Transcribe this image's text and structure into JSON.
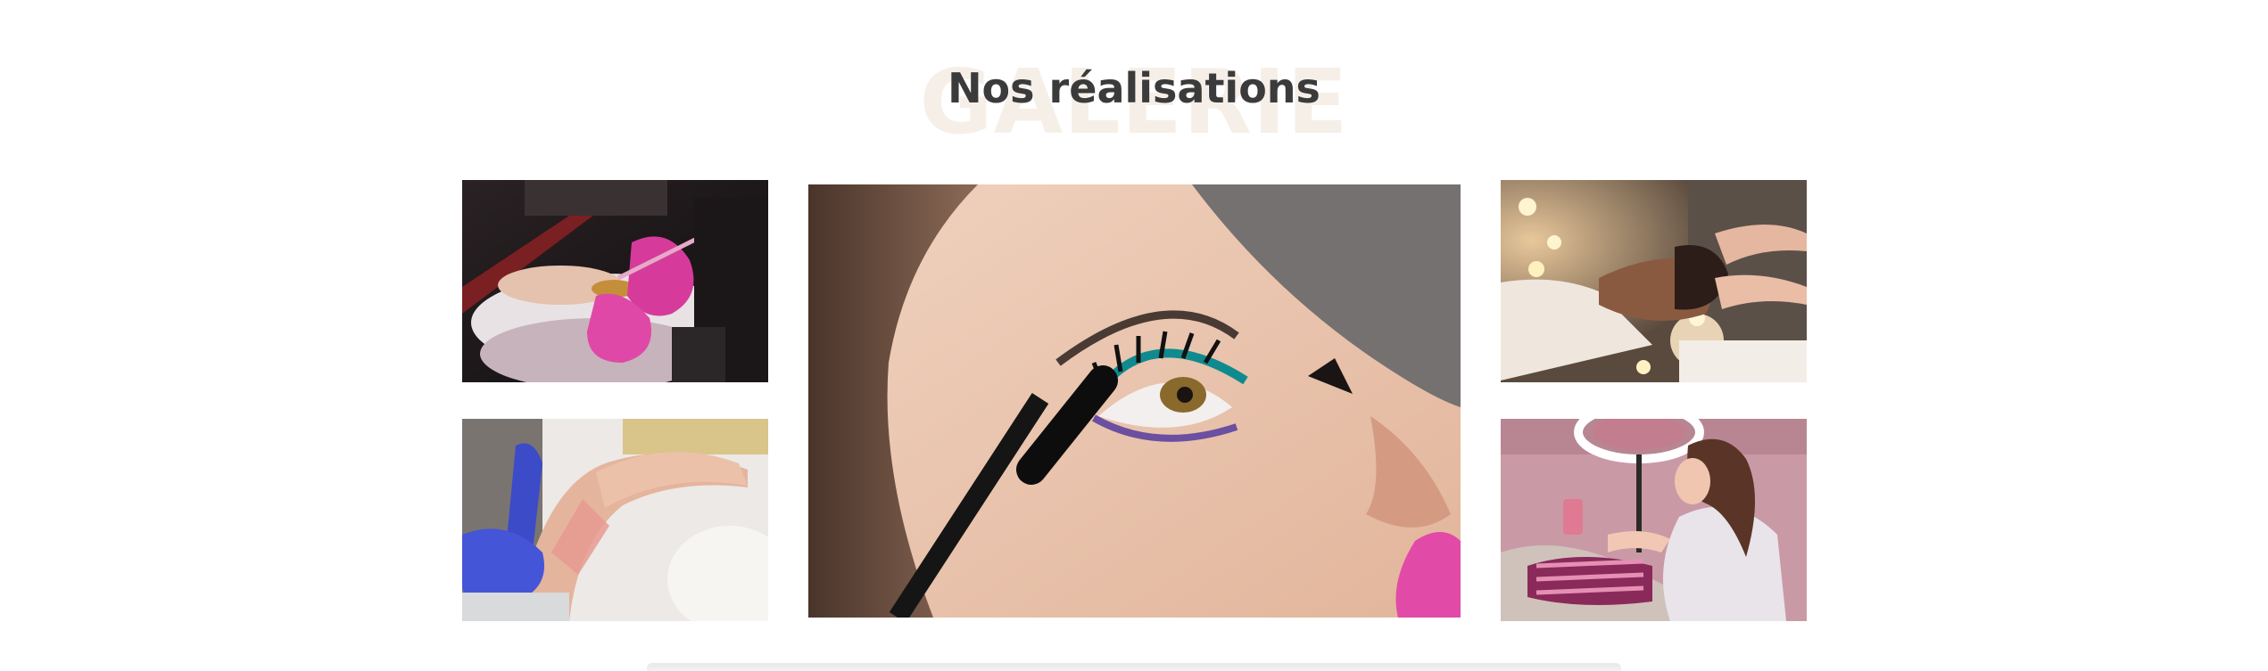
{
  "gallery": {
    "background_word": "GALERIE",
    "title": "Nos réalisations",
    "colors": {
      "title": "#3b3b3b",
      "background_word": "#f6efe8"
    },
    "images": [
      {
        "subject": "manicure-nail-art"
      },
      {
        "subject": "leg-waxing"
      },
      {
        "subject": "mascara-eye-makeup"
      },
      {
        "subject": "facial-massage-candles"
      },
      {
        "subject": "beauty-salon-treatment-ring-light"
      }
    ]
  }
}
